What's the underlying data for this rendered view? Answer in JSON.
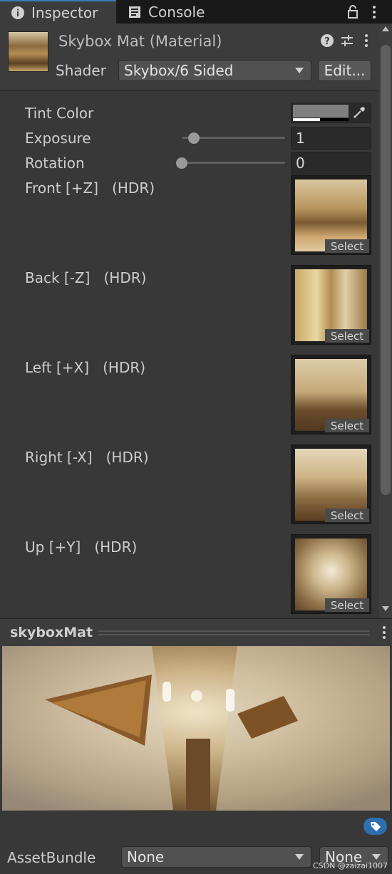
{
  "tabs": [
    {
      "label": "Inspector",
      "icon": "info-icon",
      "active": true
    },
    {
      "label": "Console",
      "icon": "console-icon",
      "active": false
    }
  ],
  "header": {
    "title": "Skybox Mat (Material)",
    "shader_label": "Shader",
    "shader_value": "Skybox/6 Sided",
    "edit_label": "Edit..."
  },
  "properties": {
    "tint_color_label": "Tint Color",
    "tint_color": "#808080",
    "exposure_label": "Exposure",
    "exposure_value": "1",
    "exposure_level": 0.12,
    "rotation_label": "Rotation",
    "rotation_value": "0",
    "rotation_level": 0.0,
    "textures": [
      {
        "label": "Front [+Z]   (HDR)",
        "select": "Select"
      },
      {
        "label": "Back [-Z]   (HDR)",
        "select": "Select"
      },
      {
        "label": "Left [+X]   (HDR)",
        "select": "Select"
      },
      {
        "label": "Right [-X]   (HDR)",
        "select": "Select"
      },
      {
        "label": "Up [+Y]   (HDR)",
        "select": "Select"
      }
    ]
  },
  "preview": {
    "title": "skyboxMat"
  },
  "footer": {
    "assetbundle_label": "AssetBundle",
    "assetbundle_value": "None",
    "variant_value": "None"
  },
  "watermark": "CSDN @zaizai1007",
  "colors": {
    "accent": "#3a79bb",
    "background": "#383838",
    "tabbar": "#191919"
  }
}
